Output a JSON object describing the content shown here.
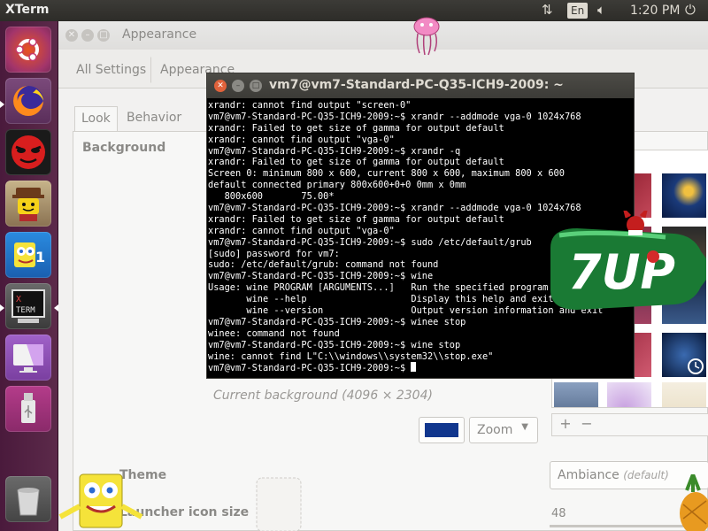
{
  "top_panel": {
    "app_name": "XTerm",
    "network_icon": "network-arrows-icon",
    "keyboard_layout": "En",
    "volume_icon": "volume-icon",
    "clock": "1:20 PM",
    "power_icon": "power-icon"
  },
  "launcher": {
    "items": [
      {
        "name": "ubuntu-dash",
        "icon": "ubuntu-logo-icon"
      },
      {
        "name": "firefox",
        "icon": "firefox-icon"
      },
      {
        "name": "devil-app",
        "icon": "red-face-icon"
      },
      {
        "name": "lego-app",
        "icon": "lego-figure-icon"
      },
      {
        "name": "spongebob-app",
        "icon": "spongebob-icon"
      },
      {
        "name": "xterm",
        "icon": "xterm-icon",
        "label": "X\nTERM"
      },
      {
        "name": "system-settings",
        "icon": "monitor-icon"
      },
      {
        "name": "usb-drive",
        "icon": "usb-icon"
      },
      {
        "name": "trash",
        "icon": "trash-icon"
      }
    ]
  },
  "settings": {
    "window_title": "Appearance",
    "crumbs": {
      "all": "All Settings",
      "current": "Appearance"
    },
    "tabs": {
      "look": "Look",
      "behavior": "Behavior"
    },
    "background_label": "Background",
    "current_background": "Current background (4096 × 2304)",
    "zoom_value": "Zoom",
    "color_value": "#10368d",
    "add_label": "+",
    "remove_label": "−",
    "theme_label": "Theme",
    "theme_value": "Ambiance",
    "theme_default": "(default)",
    "icon_size_label": "Launcher icon size",
    "icon_size_value": "48"
  },
  "xterm": {
    "title": "vm7@vm7-Standard-PC-Q35-ICH9-2009: ~",
    "lines": [
      "xrandr: cannot find output \"screen-0\"",
      "vm7@vm7-Standard-PC-Q35-ICH9-2009:~$ xrandr --addmode vga-0 1024x768",
      "xrandr: Failed to get size of gamma for output default",
      "xrandr: cannot find output \"vga-0\"",
      "vm7@vm7-Standard-PC-Q35-ICH9-2009:~$ xrandr -q",
      "xrandr: Failed to get size of gamma for output default",
      "Screen 0: minimum 800 x 600, current 800 x 600, maximum 800 x 600",
      "default connected primary 800x600+0+0 0mm x 0mm",
      "   800x600       75.00*",
      "vm7@vm7-Standard-PC-Q35-ICH9-2009:~$ xrandr --addmode vga-0 1024x768",
      "xrandr: Failed to get size of gamma for output default",
      "xrandr: cannot find output \"vga-0\"",
      "vm7@vm7-Standard-PC-Q35-ICH9-2009:~$ sudo /etc/default/grub",
      "[sudo] password for vm7:",
      "sudo: /etc/default/grub: command not found",
      "vm7@vm7-Standard-PC-Q35-ICH9-2009:~$ wine",
      "Usage: wine PROGRAM [ARGUMENTS...]   Run the specified program",
      "       wine --help                   Display this help and exit",
      "       wine --version                Output version information and exit",
      "vm7@vm7-Standard-PC-Q35-ICH9-2009:~$ winee stop",
      "winee: command not found",
      "vm7@vm7-Standard-PC-Q35-ICH9-2009:~$ wine stop",
      "wine: cannot find L\"C:\\\\windows\\\\system32\\\\stop.exe\"",
      "vm7@vm7-Standard-PC-Q35-ICH9-2009:~$ "
    ]
  },
  "decor": {
    "soda_text": "7UP"
  }
}
